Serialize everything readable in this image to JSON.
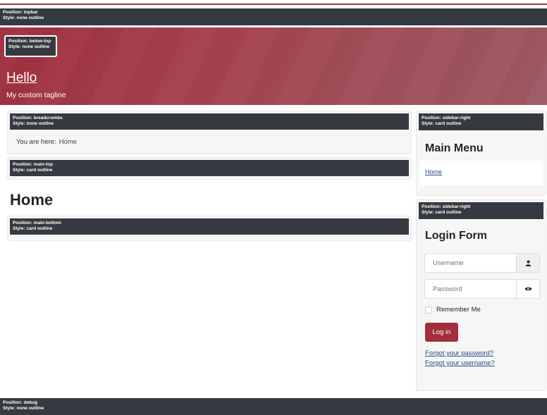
{
  "topbar": {
    "position": "Position: topbar",
    "style": "Style: none outline"
  },
  "below_top": {
    "position": "Position: below-top",
    "style": "Style: none outline"
  },
  "header": {
    "site_title": "Hello",
    "tagline": "My custom tagline"
  },
  "breadcrumbs": {
    "position": "Position: breadcrumbs",
    "style": "Style: none outline",
    "prefix": "You are here:",
    "home": "Home"
  },
  "main_top": {
    "position": "Position: main-top",
    "style": "Style: card outline"
  },
  "page_title": "Home",
  "main_bottom": {
    "position": "Position: main-bottom",
    "style": "Style: card outline"
  },
  "sidebar_menu": {
    "position": "Position: sidebar-right",
    "style": "Style: card outline",
    "title": "Main Menu",
    "items": [
      {
        "label": "Home"
      }
    ]
  },
  "sidebar_login": {
    "position": "Position: sidebar-right",
    "style": "Style: card outline",
    "title": "Login Form",
    "username_placeholder": "Username",
    "password_placeholder": "Password",
    "remember_label": "Remember Me",
    "login_label": "Log in",
    "forgot_password": "Forgot your password?",
    "forgot_username": "Forgot your username?"
  },
  "debug": {
    "position": "Position: debug",
    "style": "Style: none outline"
  },
  "icons": {
    "username": "user-icon",
    "password": "eye-icon"
  },
  "colors": {
    "accent": "#a42e3e",
    "position_bar": "#343a40",
    "link": "#2a4a8a"
  }
}
